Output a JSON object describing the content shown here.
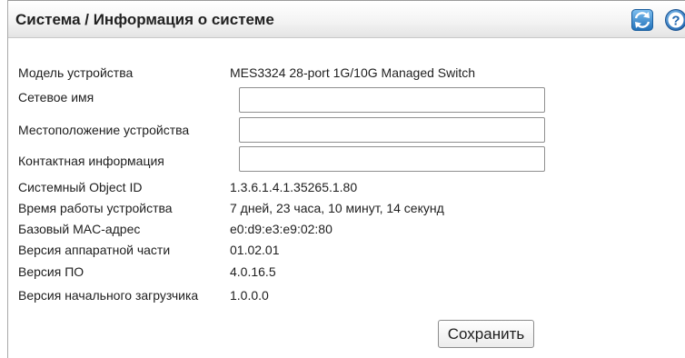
{
  "header": {
    "title": "Система / Информация о системе",
    "refresh_icon": "refresh-icon",
    "help_icon": "help-icon",
    "icon_color": "#2f7fc6"
  },
  "form": {
    "model_label": "Модель устройства",
    "model_value": "MES3324 28-port 1G/10G Managed Switch",
    "hostname_label": "Сетевое имя",
    "hostname_value": "",
    "location_label": "Местоположение устройства",
    "location_value": "",
    "contact_label": "Контактная информация",
    "contact_value": "",
    "object_id_label": "Системный Object ID",
    "object_id_value": "1.3.6.1.4.1.35265.1.80",
    "uptime_label": "Время работы устройства",
    "uptime_value": "7 дней, 23 часа, 10 минут, 14 секунд",
    "mac_label": "Базовый MAC-адрес",
    "mac_value": "e0:d9:e3:e9:02:80",
    "hw_version_label": "Версия аппаратной части",
    "hw_version_value": "01.02.01",
    "sw_version_label": "Версия ПО",
    "sw_version_value": "4.0.16.5",
    "boot_version_label": "Версия начального загрузчика",
    "boot_version_value": "1.0.0.0"
  },
  "actions": {
    "save_label": "Сохранить"
  }
}
